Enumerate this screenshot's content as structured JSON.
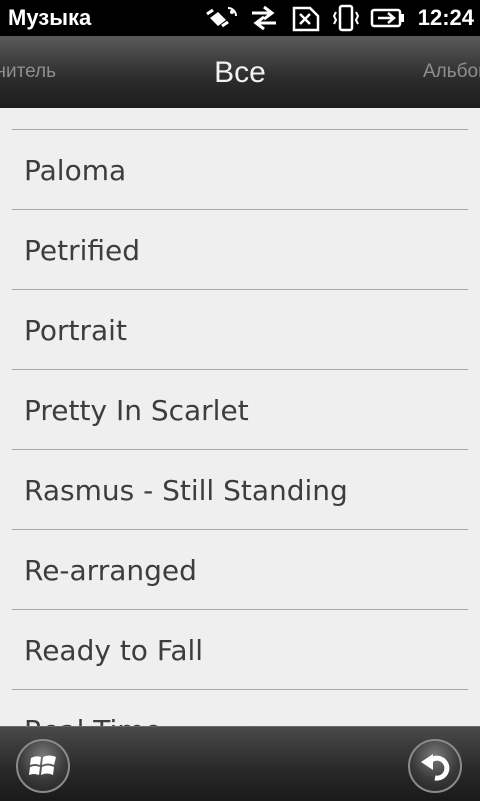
{
  "statusbar": {
    "title": "Музыка",
    "time": "12:24",
    "icons": [
      "gps-icon",
      "data-transfer-icon",
      "no-sim-icon",
      "vibrate-icon",
      "battery-charging-icon"
    ]
  },
  "tabs": {
    "left": "Исполнитель",
    "current": "Все",
    "right": "Альбом"
  },
  "songs": [
    "Paloma",
    "Petrified",
    "Portrait",
    "Pretty In Scarlet",
    "Rasmus - Still Standing",
    "Re-arranged",
    "Ready to Fall",
    "Real Time"
  ],
  "softkeys": {
    "left_icon": "windows-start-icon",
    "right_icon": "back-arrow-icon"
  }
}
